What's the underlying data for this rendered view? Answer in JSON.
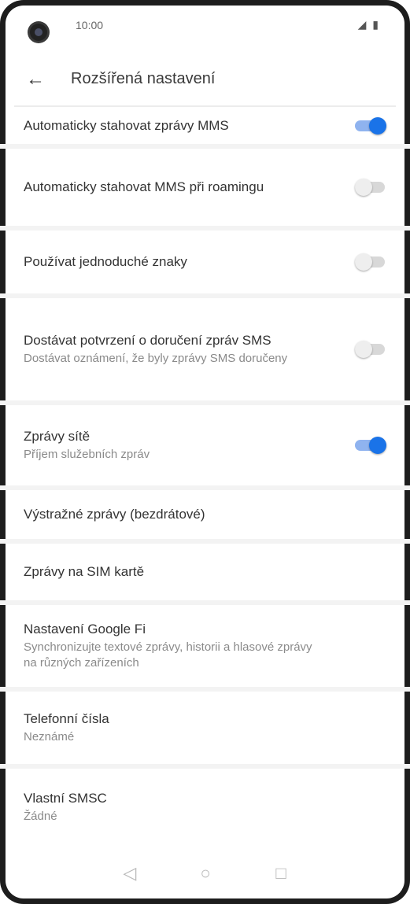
{
  "status_bar": {
    "time": "10:00",
    "icons": "◢ ▮"
  },
  "header": {
    "back_icon": "arrow-left-icon",
    "title": "Rozšířená nastavení"
  },
  "items": [
    {
      "title": "Automaticky stahovat zprávy MMS",
      "subtitle": "",
      "toggle": true
    },
    {
      "title": "Automaticky stahovat MMS při roamingu",
      "subtitle": "",
      "toggle": false
    },
    {
      "title": "Používat jednoduché znaky",
      "subtitle": "",
      "toggle": false
    },
    {
      "title": "Dostávat potvrzení o doručení zpráv SMS",
      "subtitle": "Dostávat oznámení, že byly zprávy SMS doručeny",
      "toggle": false
    },
    {
      "title": "Zprávy sítě",
      "subtitle": "Příjem služebních zpráv",
      "toggle": true
    },
    {
      "title": "Výstražné zprávy (bezdrátové)",
      "subtitle": ""
    },
    {
      "title": "Zprávy na SIM kartě",
      "subtitle": ""
    },
    {
      "title": "Nastavení Google Fi",
      "subtitle": "Synchronizujte textové zprávy, historii a hlasové zprávy na různých zařízeních"
    },
    {
      "title": "Telefonní čísla",
      "subtitle": "Neznámé"
    },
    {
      "title": "Vlastní SMSC",
      "subtitle": "Žádné"
    }
  ],
  "nav": {
    "back": "◁",
    "home": "○",
    "recents": "□"
  },
  "colors": {
    "accent": "#1a73e8",
    "toggle_on_track": "#8fb3ef",
    "toggle_off_track": "#d8d8d8"
  }
}
